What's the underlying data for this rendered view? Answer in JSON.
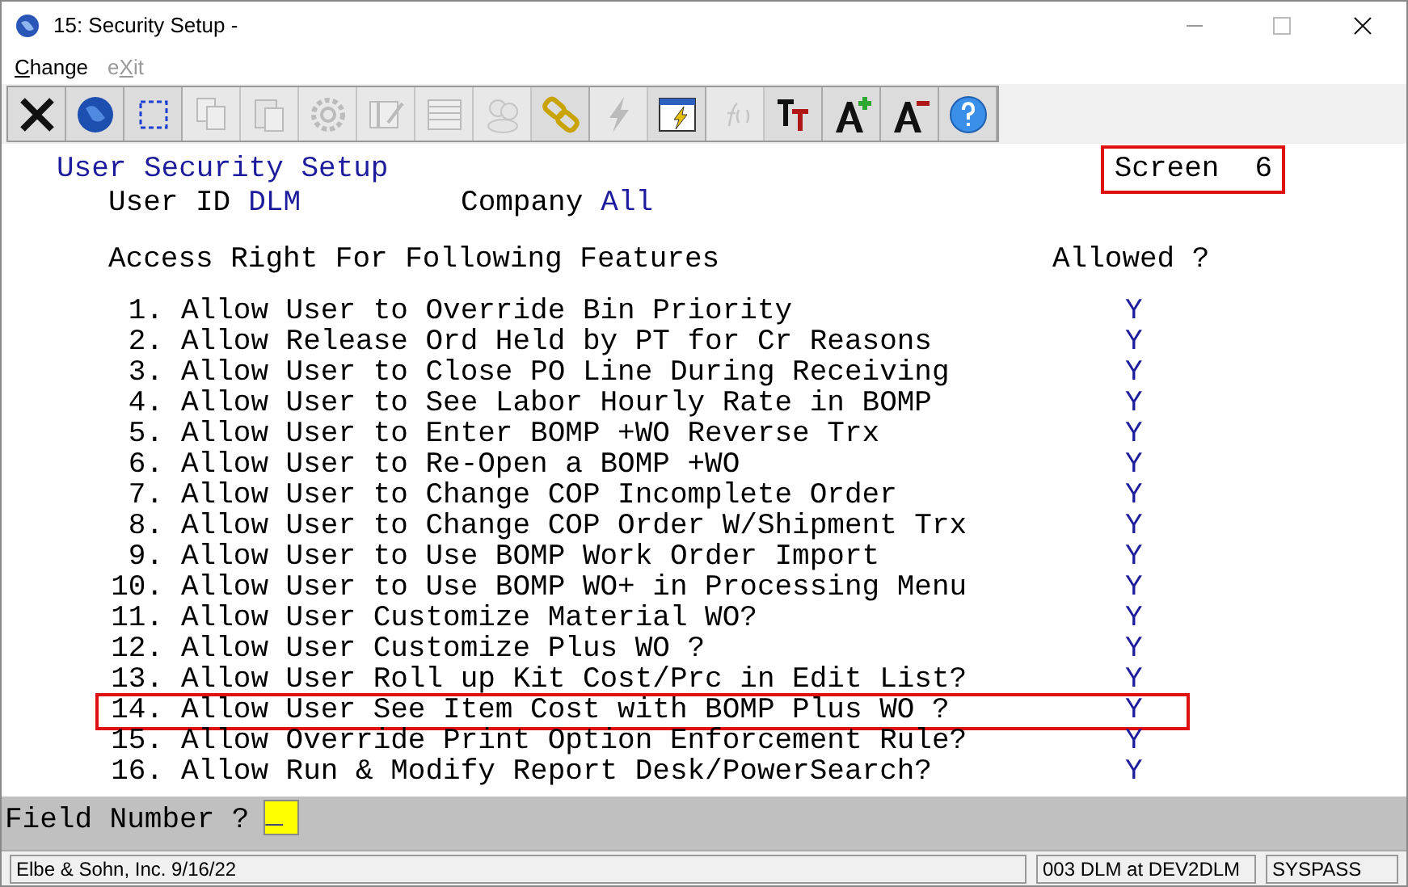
{
  "window": {
    "title": "15: Security Setup -"
  },
  "menu": [
    {
      "mnemonic": "C",
      "after": "hange",
      "disabled": false
    },
    {
      "before": "e",
      "mnemonic": "X",
      "after": "it",
      "disabled": true
    }
  ],
  "toolbar": [
    {
      "kind": "close",
      "disabled": false
    },
    {
      "kind": "globe",
      "disabled": false
    },
    {
      "kind": "select",
      "disabled": false
    },
    {
      "kind": "copy",
      "disabled": true
    },
    {
      "kind": "paste",
      "disabled": true
    },
    {
      "kind": "gear",
      "disabled": true
    },
    {
      "kind": "form",
      "disabled": true
    },
    {
      "kind": "table",
      "disabled": true
    },
    {
      "kind": "people",
      "disabled": true
    },
    {
      "kind": "link",
      "disabled": false
    },
    {
      "kind": "bolt",
      "disabled": true
    },
    {
      "kind": "boltwindow",
      "disabled": false
    },
    {
      "kind": "fx",
      "disabled": true
    },
    {
      "kind": "tt",
      "disabled": false
    },
    {
      "kind": "aplus",
      "disabled": false
    },
    {
      "kind": "aminus",
      "disabled": false
    },
    {
      "kind": "help",
      "disabled": false
    }
  ],
  "screen": {
    "title": "User Security Setup",
    "screen_label": "Screen",
    "screen_number": "6",
    "screen_highlighted": true,
    "user_id_label": "User ID",
    "user_id": "DLM",
    "company_label": "Company",
    "company": "All",
    "heading": "Access Right For Following Features",
    "allowed_heading": "Allowed ?",
    "rows": [
      {
        "number": "1.",
        "label": "Allow User to Override Bin Priority",
        "allowed": "Y",
        "highlighted": false
      },
      {
        "number": "2.",
        "label": "Allow Release Ord Held by PT for Cr Reasons",
        "allowed": "Y",
        "highlighted": false
      },
      {
        "number": "3.",
        "label": "Allow User to Close PO Line During Receiving",
        "allowed": "Y",
        "highlighted": false
      },
      {
        "number": "4.",
        "label": "Allow User to See Labor Hourly Rate in BOMP",
        "allowed": "Y",
        "highlighted": false
      },
      {
        "number": "5.",
        "label": "Allow User to Enter BOMP +WO Reverse Trx",
        "allowed": "Y",
        "highlighted": false
      },
      {
        "number": "6.",
        "label": "Allow User to Re-Open a BOMP +WO",
        "allowed": "Y",
        "highlighted": false
      },
      {
        "number": "7.",
        "label": "Allow User to Change COP Incomplete Order",
        "allowed": "Y",
        "highlighted": false
      },
      {
        "number": "8.",
        "label": "Allow User to Change COP Order W/Shipment Trx",
        "allowed": "Y",
        "highlighted": false
      },
      {
        "number": "9.",
        "label": "Allow User to Use BOMP Work Order Import",
        "allowed": "Y",
        "highlighted": false
      },
      {
        "number": "10.",
        "label": "Allow User to Use BOMP WO+ in Processing Menu",
        "allowed": "Y",
        "highlighted": false
      },
      {
        "number": "11.",
        "label": "Allow User Customize Material WO?",
        "allowed": "Y",
        "highlighted": false
      },
      {
        "number": "12.",
        "label": "Allow User Customize Plus WO ?",
        "allowed": "Y",
        "highlighted": false
      },
      {
        "number": "13.",
        "label": "Allow User Roll up Kit Cost/Prc in Edit List?",
        "allowed": "Y",
        "highlighted": false
      },
      {
        "number": "14.",
        "label": "Allow User See Item Cost with BOMP Plus WO ?",
        "allowed": "Y",
        "highlighted": true
      },
      {
        "number": "15.",
        "label": "Allow Override Print Option Enforcement Rule?",
        "allowed": "Y",
        "highlighted": false
      },
      {
        "number": "16.",
        "label": "Allow Run & Modify Report Desk/PowerSearch?",
        "allowed": "Y",
        "highlighted": false
      }
    ]
  },
  "prompt": {
    "label": "Field Number ?",
    "value": "_"
  },
  "status_bar": [
    "Elbe & Sohn, Inc. 9/16/22",
    "003 DLM at DEV2DLM",
    "SYSPASS"
  ]
}
